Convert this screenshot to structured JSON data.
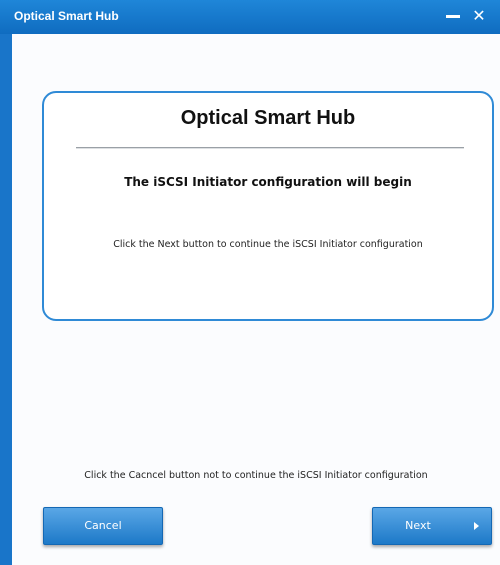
{
  "window": {
    "title": "Optical Smart Hub",
    "minimize_icon": "minimize-icon",
    "close_icon": "close-icon",
    "close_glyph": "✕"
  },
  "card": {
    "title": "Optical Smart Hub",
    "subtitle": "The iSCSI Initiator configuration will begin",
    "instruction": "Click the Next button to continue the iSCSI Initiator configuration"
  },
  "footer": {
    "cancel_note": "Click the Cacncel button not to continue the iSCSI Initiator configuration"
  },
  "buttons": {
    "cancel_label": "Cancel",
    "next_label": "Next",
    "next_icon": "arrow-right-icon"
  },
  "colors": {
    "titlebar": "#1975c9",
    "card_border": "#2f8ad6",
    "button": "#2b86d3"
  }
}
